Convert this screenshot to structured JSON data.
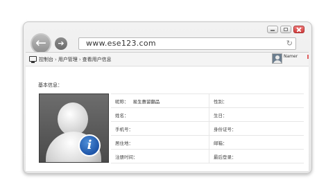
{
  "browser": {
    "url": "www.ese123.com"
  },
  "breadcrumb": {
    "items": [
      "控制台",
      "用户管理",
      "查看用户信息"
    ]
  },
  "user": {
    "name": "Namer"
  },
  "section": {
    "title": "基本信息："
  },
  "profile": {
    "rows": [
      {
        "left_label": "昵称：",
        "left_value": "易生惠留翻品",
        "right_label": "性别：",
        "right_value": ""
      },
      {
        "left_label": "姓名：",
        "left_value": "",
        "right_label": "生日：",
        "right_value": ""
      },
      {
        "left_label": "手机号：",
        "left_value": "",
        "right_label": "身份证号：",
        "right_value": ""
      },
      {
        "left_label": "居住地：",
        "left_value": "",
        "right_label": "邮箱：",
        "right_value": ""
      },
      {
        "left_label": "注册时间：",
        "left_value": "",
        "right_label": "最后登录：",
        "right_value": ""
      }
    ]
  },
  "icons": {
    "back": "back-arrow-icon",
    "forward": "forward-arrow-icon",
    "reload": "reload-icon",
    "console": "monitor-icon",
    "info": "info-icon"
  },
  "colors": {
    "info_badge": "#1e55a8",
    "close_button": "#d03a3a"
  }
}
